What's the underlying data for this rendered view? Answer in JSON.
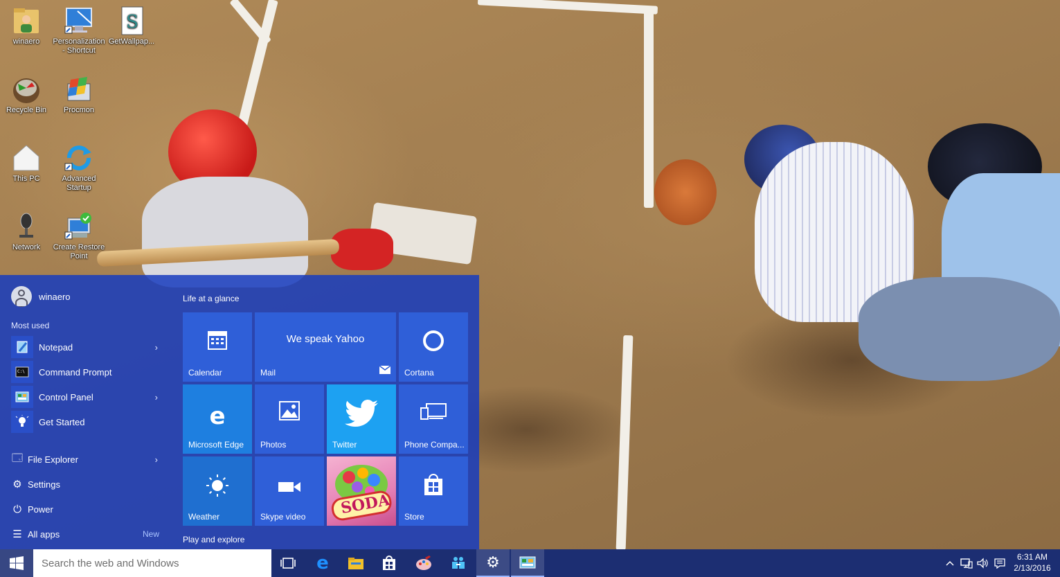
{
  "desktop": {
    "icons": [
      {
        "label": "winaero",
        "icon": "user-folder-icon"
      },
      {
        "label": "Personalization - Shortcut",
        "icon": "personalization-icon"
      },
      {
        "label": "GetWallpap...",
        "icon": "script-icon"
      },
      {
        "label": "Recycle Bin",
        "icon": "recycle-bin-icon"
      },
      {
        "label": "Procmon",
        "icon": "procmon-icon"
      },
      {
        "label": "This PC",
        "icon": "this-pc-icon"
      },
      {
        "label": "Advanced Startup",
        "icon": "advanced-startup-icon"
      },
      {
        "label": "Network",
        "icon": "network-icon"
      },
      {
        "label": "Create Restore Point",
        "icon": "restore-point-icon"
      }
    ]
  },
  "start_menu": {
    "user_name": "winaero",
    "most_used_label": "Most used",
    "most_used": [
      {
        "label": "Notepad",
        "icon": "notepad-icon",
        "has_submenu": true
      },
      {
        "label": "Command Prompt",
        "icon": "command-prompt-icon",
        "has_submenu": false
      },
      {
        "label": "Control Panel",
        "icon": "control-panel-icon",
        "has_submenu": true
      },
      {
        "label": "Get Started",
        "icon": "get-started-icon",
        "has_submenu": false
      }
    ],
    "system": [
      {
        "label": "File Explorer",
        "icon": "file-explorer-icon",
        "glyph": "🗔",
        "has_submenu": true
      },
      {
        "label": "Settings",
        "icon": "settings-icon",
        "glyph": "⚙",
        "has_submenu": false
      },
      {
        "label": "Power",
        "icon": "power-icon",
        "glyph": "⏻",
        "has_submenu": false
      },
      {
        "label": "All apps",
        "icon": "all-apps-icon",
        "glyph": "☰",
        "has_submenu": false,
        "badge": "New"
      }
    ],
    "groups": [
      "Life at a glance",
      "Play and explore"
    ],
    "tiles": [
      {
        "label": "Calendar",
        "icon": "calendar-icon",
        "color": "#2f5fd8"
      },
      {
        "label": "Mail",
        "icon": "mail-icon",
        "color": "#2f5fd8",
        "headline": "We speak Yahoo"
      },
      {
        "label": "Cortana",
        "icon": "cortana-icon",
        "color": "#2f5fd8"
      },
      {
        "label": "Microsoft Edge",
        "icon": "edge-icon",
        "color": "#1e7fe0"
      },
      {
        "label": "Photos",
        "icon": "photos-icon",
        "color": "#2f5fd8"
      },
      {
        "label": "Twitter",
        "icon": "twitter-icon",
        "color": "#1da1f2"
      },
      {
        "label": "Phone Compa...",
        "icon": "phone-companion-icon",
        "color": "#2f5fd8"
      },
      {
        "label": "Weather",
        "icon": "weather-icon",
        "color": "#1f6fd0"
      },
      {
        "label": "Skype video",
        "icon": "skype-video-icon",
        "color": "#2f5fd8"
      },
      {
        "label": "SODA",
        "icon": "candy-crush-icon",
        "color": "#e8a6c8"
      },
      {
        "label": "Store",
        "icon": "store-icon",
        "color": "#2f5fd8"
      }
    ]
  },
  "taskbar": {
    "search_placeholder": "Search the web and Windows",
    "pinned": [
      {
        "name": "task-view-icon"
      },
      {
        "name": "edge-icon"
      },
      {
        "name": "file-explorer-icon"
      },
      {
        "name": "store-icon"
      },
      {
        "name": "paint-icon"
      },
      {
        "name": "people-icon"
      },
      {
        "name": "settings-icon"
      },
      {
        "name": "control-panel-icon"
      }
    ],
    "time": "6:31 AM",
    "date": "2/13/2016"
  },
  "colors": {
    "start_bg": "#1b3fc0",
    "tile_blue": "#2f5fd8",
    "taskbar_bg": "#1c2e72",
    "twitter": "#1da1f2"
  }
}
